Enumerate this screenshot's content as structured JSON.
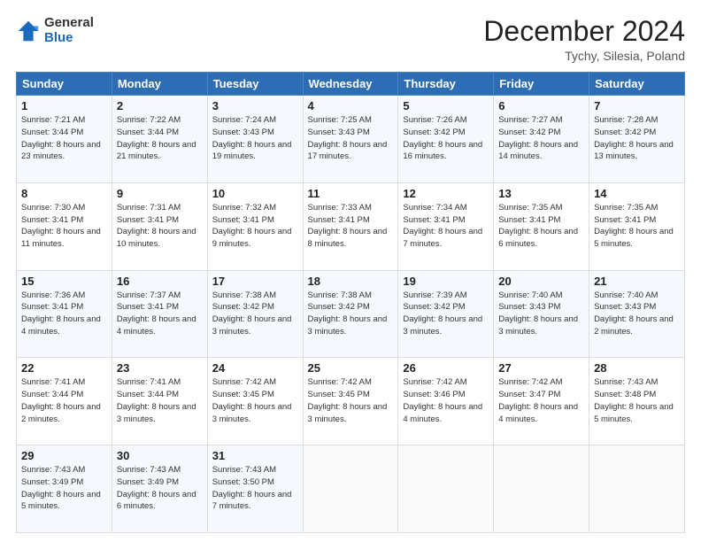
{
  "header": {
    "logo_general": "General",
    "logo_blue": "Blue",
    "month_title": "December 2024",
    "location": "Tychy, Silesia, Poland"
  },
  "days_of_week": [
    "Sunday",
    "Monday",
    "Tuesday",
    "Wednesday",
    "Thursday",
    "Friday",
    "Saturday"
  ],
  "weeks": [
    [
      {
        "day": "1",
        "sunrise": "7:21 AM",
        "sunset": "3:44 PM",
        "daylight": "8 hours and 23 minutes."
      },
      {
        "day": "2",
        "sunrise": "7:22 AM",
        "sunset": "3:44 PM",
        "daylight": "8 hours and 21 minutes."
      },
      {
        "day": "3",
        "sunrise": "7:24 AM",
        "sunset": "3:43 PM",
        "daylight": "8 hours and 19 minutes."
      },
      {
        "day": "4",
        "sunrise": "7:25 AM",
        "sunset": "3:43 PM",
        "daylight": "8 hours and 17 minutes."
      },
      {
        "day": "5",
        "sunrise": "7:26 AM",
        "sunset": "3:42 PM",
        "daylight": "8 hours and 16 minutes."
      },
      {
        "day": "6",
        "sunrise": "7:27 AM",
        "sunset": "3:42 PM",
        "daylight": "8 hours and 14 minutes."
      },
      {
        "day": "7",
        "sunrise": "7:28 AM",
        "sunset": "3:42 PM",
        "daylight": "8 hours and 13 minutes."
      }
    ],
    [
      {
        "day": "8",
        "sunrise": "7:30 AM",
        "sunset": "3:41 PM",
        "daylight": "8 hours and 11 minutes."
      },
      {
        "day": "9",
        "sunrise": "7:31 AM",
        "sunset": "3:41 PM",
        "daylight": "8 hours and 10 minutes."
      },
      {
        "day": "10",
        "sunrise": "7:32 AM",
        "sunset": "3:41 PM",
        "daylight": "8 hours and 9 minutes."
      },
      {
        "day": "11",
        "sunrise": "7:33 AM",
        "sunset": "3:41 PM",
        "daylight": "8 hours and 8 minutes."
      },
      {
        "day": "12",
        "sunrise": "7:34 AM",
        "sunset": "3:41 PM",
        "daylight": "8 hours and 7 minutes."
      },
      {
        "day": "13",
        "sunrise": "7:35 AM",
        "sunset": "3:41 PM",
        "daylight": "8 hours and 6 minutes."
      },
      {
        "day": "14",
        "sunrise": "7:35 AM",
        "sunset": "3:41 PM",
        "daylight": "8 hours and 5 minutes."
      }
    ],
    [
      {
        "day": "15",
        "sunrise": "7:36 AM",
        "sunset": "3:41 PM",
        "daylight": "8 hours and 4 minutes."
      },
      {
        "day": "16",
        "sunrise": "7:37 AM",
        "sunset": "3:41 PM",
        "daylight": "8 hours and 4 minutes."
      },
      {
        "day": "17",
        "sunrise": "7:38 AM",
        "sunset": "3:42 PM",
        "daylight": "8 hours and 3 minutes."
      },
      {
        "day": "18",
        "sunrise": "7:38 AM",
        "sunset": "3:42 PM",
        "daylight": "8 hours and 3 minutes."
      },
      {
        "day": "19",
        "sunrise": "7:39 AM",
        "sunset": "3:42 PM",
        "daylight": "8 hours and 3 minutes."
      },
      {
        "day": "20",
        "sunrise": "7:40 AM",
        "sunset": "3:43 PM",
        "daylight": "8 hours and 3 minutes."
      },
      {
        "day": "21",
        "sunrise": "7:40 AM",
        "sunset": "3:43 PM",
        "daylight": "8 hours and 2 minutes."
      }
    ],
    [
      {
        "day": "22",
        "sunrise": "7:41 AM",
        "sunset": "3:44 PM",
        "daylight": "8 hours and 2 minutes."
      },
      {
        "day": "23",
        "sunrise": "7:41 AM",
        "sunset": "3:44 PM",
        "daylight": "8 hours and 3 minutes."
      },
      {
        "day": "24",
        "sunrise": "7:42 AM",
        "sunset": "3:45 PM",
        "daylight": "8 hours and 3 minutes."
      },
      {
        "day": "25",
        "sunrise": "7:42 AM",
        "sunset": "3:45 PM",
        "daylight": "8 hours and 3 minutes."
      },
      {
        "day": "26",
        "sunrise": "7:42 AM",
        "sunset": "3:46 PM",
        "daylight": "8 hours and 4 minutes."
      },
      {
        "day": "27",
        "sunrise": "7:42 AM",
        "sunset": "3:47 PM",
        "daylight": "8 hours and 4 minutes."
      },
      {
        "day": "28",
        "sunrise": "7:43 AM",
        "sunset": "3:48 PM",
        "daylight": "8 hours and 5 minutes."
      }
    ],
    [
      {
        "day": "29",
        "sunrise": "7:43 AM",
        "sunset": "3:49 PM",
        "daylight": "8 hours and 5 minutes."
      },
      {
        "day": "30",
        "sunrise": "7:43 AM",
        "sunset": "3:49 PM",
        "daylight": "8 hours and 6 minutes."
      },
      {
        "day": "31",
        "sunrise": "7:43 AM",
        "sunset": "3:50 PM",
        "daylight": "8 hours and 7 minutes."
      },
      null,
      null,
      null,
      null
    ]
  ],
  "labels": {
    "sunrise_prefix": "Sunrise: ",
    "sunset_prefix": "Sunset: ",
    "daylight_prefix": "Daylight: "
  }
}
